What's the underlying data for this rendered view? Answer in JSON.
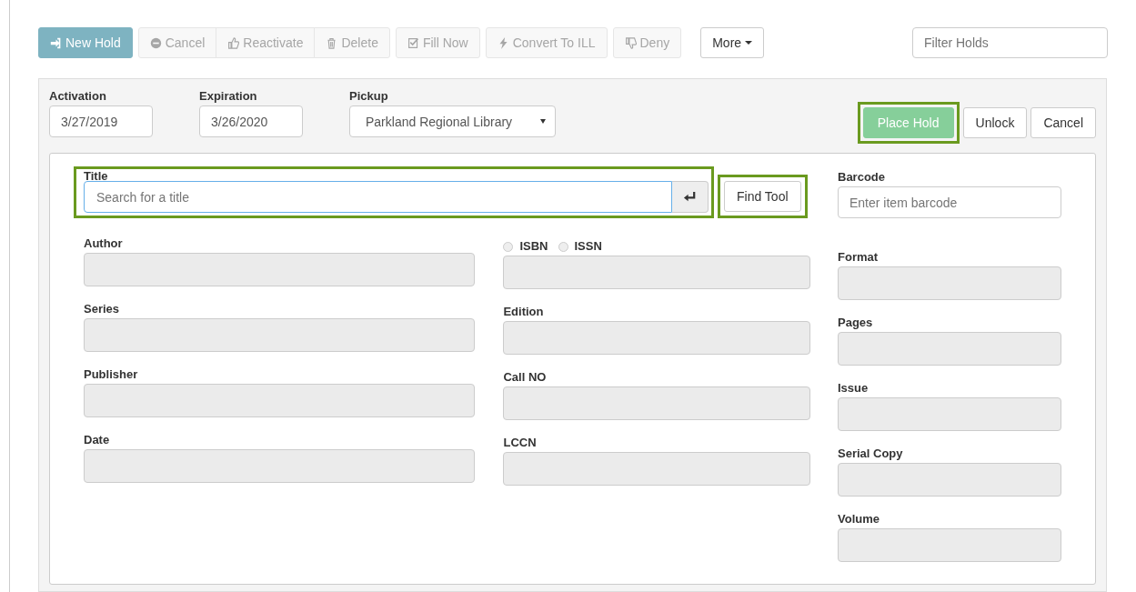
{
  "toolbar": {
    "buttons": [
      {
        "label": "New Hold",
        "kind": "primary",
        "disabled": false
      },
      {
        "label": "Cancel",
        "kind": "default",
        "disabled": true
      },
      {
        "label": "Reactivate",
        "kind": "default",
        "disabled": true
      },
      {
        "label": "Delete",
        "kind": "default",
        "disabled": true
      },
      {
        "label": "Fill Now",
        "kind": "default",
        "disabled": true
      },
      {
        "label": "Convert To ILL",
        "kind": "default",
        "disabled": true
      },
      {
        "label": "Deny",
        "kind": "default",
        "disabled": true
      }
    ],
    "more": {
      "label": "More"
    },
    "filter": {
      "placeholder": "Filter Holds"
    }
  },
  "header": {
    "activation": {
      "label": "Activation",
      "value": "3/27/2019"
    },
    "expiration": {
      "label": "Expiration",
      "value": "3/26/2020"
    },
    "pickup": {
      "label": "Pickup",
      "value": "Parkland Regional Library"
    },
    "actions": [
      {
        "label": "Place Hold",
        "kind": "success",
        "highlighted": true
      },
      {
        "label": "Unlock",
        "kind": "default",
        "highlighted": false
      },
      {
        "label": "Cancel",
        "kind": "default",
        "highlighted": false
      }
    ]
  },
  "form": {
    "title": {
      "label": "Title",
      "placeholder": "Search for a title",
      "highlighted": true
    },
    "find_tool": {
      "label": "Find Tool",
      "highlighted": true
    },
    "barcode": {
      "label": "Barcode",
      "placeholder": "Enter item barcode"
    },
    "left_fields": [
      "Author",
      "Series",
      "Publisher",
      "Date"
    ],
    "id_options": [
      {
        "label": "ISBN",
        "selected": false
      },
      {
        "label": "ISSN",
        "selected": false
      }
    ],
    "middle_fields": [
      "Edition",
      "Call NO",
      "LCCN"
    ],
    "right_fields": [
      "Format",
      "Pages",
      "Issue",
      "Serial Copy",
      "Volume"
    ]
  }
}
